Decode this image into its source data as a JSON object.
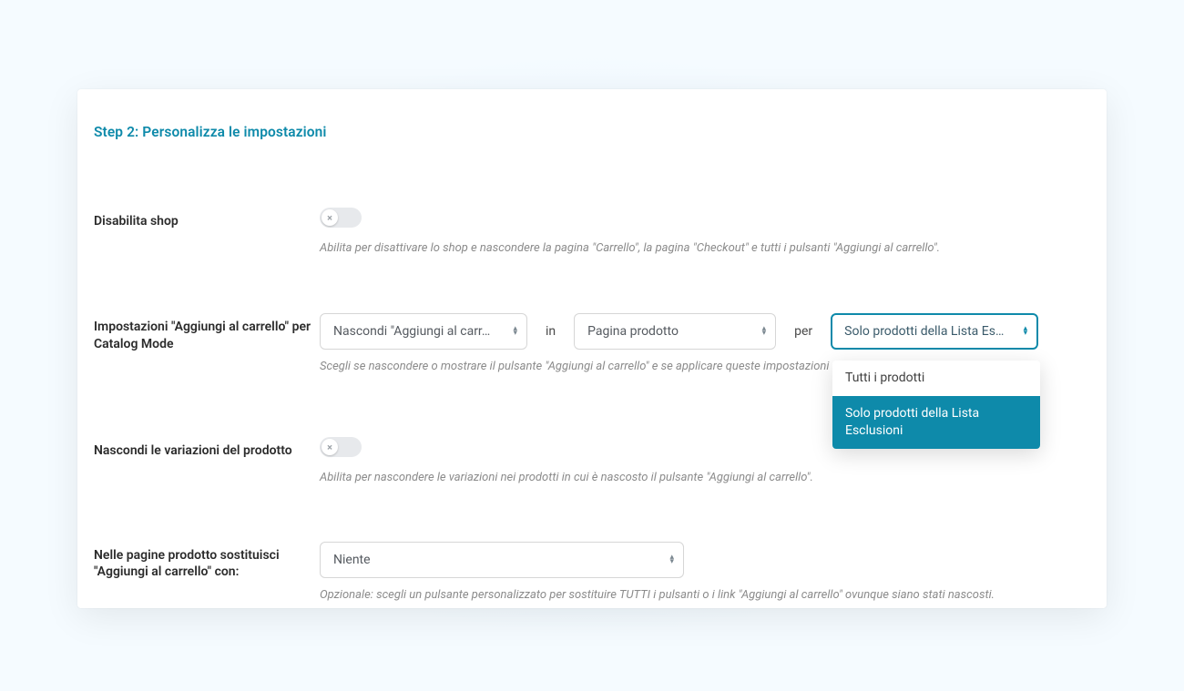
{
  "step_title": "Step 2: Personalizza le impostazioni",
  "rows": {
    "disable_shop": {
      "label": "Disabilita shop",
      "desc": "Abilita per disattivare lo shop e nascondere la pagina \"Carrello\", la pagina \"Checkout\" e tutti i pulsanti \"Aggiungi al carrello\".",
      "toggle_state": "off"
    },
    "add_to_cart": {
      "label": "Impostazioni \"Aggiungi al carrello\" per Catalog Mode",
      "select_action": "Nascondi \"Aggiungi al carr…",
      "word_in": "in",
      "select_where": "Pagina prodotto",
      "word_per": "per",
      "select_scope": "Solo prodotti della Lista Esc…",
      "desc": "Scegli se nascondere o mostrare il pulsante \"Aggiungi al carrello\" e se applicare queste impostazioni a tutti i                                          sclusioni.",
      "options": {
        "opt1": "Tutti i prodotti",
        "opt2": "Solo prodotti della Lista Esclusioni"
      }
    },
    "hide_variations": {
      "label": "Nascondi le variazioni del prodotto",
      "desc": "Abilita per nascondere le variazioni nei prodotti in cui è nascosto il pulsante \"Aggiungi al carrello\".",
      "toggle_state": "off"
    },
    "replace_with": {
      "label": "Nelle pagine prodotto sostituisci \"Aggiungi al carrello\" con:",
      "select_value": "Niente",
      "desc": "Opzionale: scegli un pulsante personalizzato per sostituire TUTTI i pulsanti o i link \"Aggiungi al carrello\" ovunque siano stati nascosti."
    }
  }
}
